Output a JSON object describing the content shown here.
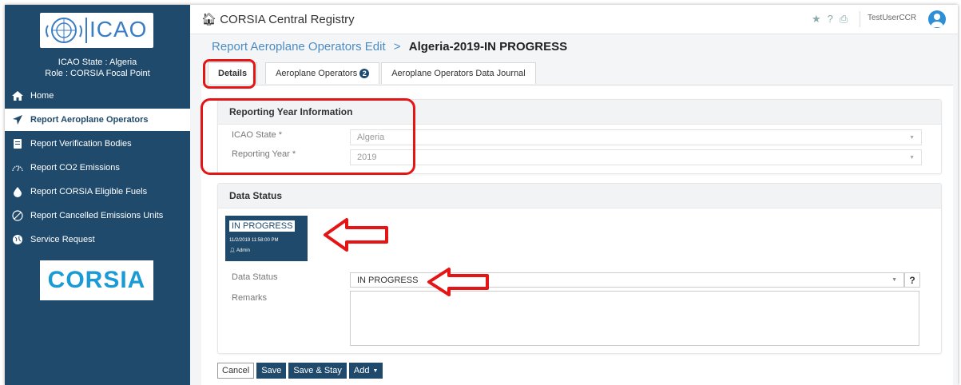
{
  "sidebar": {
    "logo_text": "ICAO",
    "icao_state": "ICAO State : Algeria",
    "role": "Role : CORSIA Focal Point",
    "items": [
      {
        "label": "Home",
        "icon": "home-icon"
      },
      {
        "label": "Report Aeroplane Operators",
        "icon": "airplane-icon"
      },
      {
        "label": "Report Verification Bodies",
        "icon": "document-icon"
      },
      {
        "label": "Report CO2 Emissions",
        "icon": "gauge-icon"
      },
      {
        "label": "Report CORSIA Eligible Fuels",
        "icon": "fuel-drop-icon"
      },
      {
        "label": "Report Cancelled Emissions Units",
        "icon": "cancel-icon"
      },
      {
        "label": "Service Request",
        "icon": "globe-icon"
      }
    ],
    "corsia_logo": "CORSIA"
  },
  "topbar": {
    "title": "CORSIA Central Registry",
    "user": "TestUserCCR"
  },
  "breadcrumb": {
    "link": "Report Aeroplane Operators Edit",
    "separator": ">",
    "current": "Algeria-2019-IN PROGRESS"
  },
  "tabs": [
    {
      "label": "Details"
    },
    {
      "label": "Aeroplane Operators",
      "badge": "2"
    },
    {
      "label": "Aeroplane Operators Data Journal"
    }
  ],
  "reporting_year": {
    "title": "Reporting Year Information",
    "state_label": "ICAO State *",
    "state_value": "Algeria",
    "year_label": "Reporting Year *",
    "year_value": "2019"
  },
  "data_status": {
    "title": "Data Status",
    "card_status": "IN PROGRESS",
    "card_date": "11/2/2019 11:58:00 PM",
    "card_user": "Admin",
    "status_label": "Data Status",
    "status_value": "IN PROGRESS",
    "help": "?",
    "remarks_label": "Remarks"
  },
  "buttons": {
    "cancel": "Cancel",
    "save": "Save",
    "save_stay": "Save & Stay",
    "add": "Add"
  },
  "colors": {
    "sidebar": "#1f4a6b",
    "link": "#4c8cc4",
    "highlight": "#e51515"
  }
}
